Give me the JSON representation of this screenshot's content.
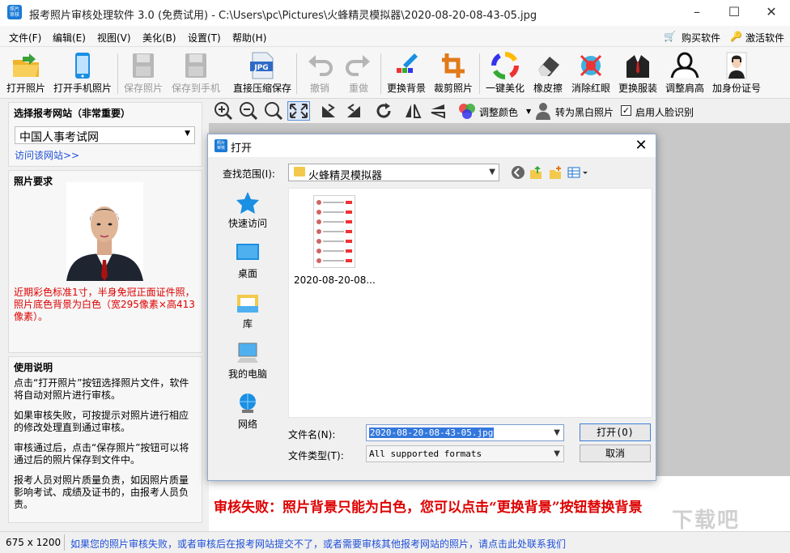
{
  "window": {
    "title": "报考照片审核处理软件 3.0 (免费试用) - C:\\Users\\pc\\Pictures\\火蜂精灵模拟器\\2020-08-20-08-43-05.jpg",
    "icon_text": "照片 审核"
  },
  "menu": {
    "items": [
      "文件(F)",
      "编辑(E)",
      "视图(V)",
      "美化(B)",
      "设置(T)",
      "帮助(H)"
    ],
    "buy": "购买软件",
    "activate": "激活软件"
  },
  "toolbar": {
    "open_photo": "打开照片",
    "open_phone_photo": "打开手机照片",
    "save_photo": "保存照片",
    "save_to_phone": "保存到手机",
    "compress_save": "直接压缩保存",
    "compress_badge": "JPG",
    "undo": "撤销",
    "redo": "重做",
    "change_bg": "更换背景",
    "crop": "裁剪照片",
    "beautify": "一键美化",
    "eraser": "橡皮擦",
    "remove_redeye": "消除红眼",
    "change_clothes": "更换服装",
    "adjust_shoulder": "调整肩高",
    "add_id": "加身份证号"
  },
  "left": {
    "site_title": "选择报考网站（非常重要）",
    "site_value": "中国人事考试网",
    "visit_link": "访问该网站>>",
    "req_title": "照片要求",
    "req_text": "近期彩色标准1寸，半身免冠正面证件照，照片底色背景为白色（宽295像素×高413像素）。",
    "usage_title": "使用说明",
    "usage_paragraphs": [
      "点击“打开照片”按钮选择照片文件，软件将自动对照片进行审核。",
      "如果审核失败，可按提示对照片进行相应的修改处理直到通过审核。",
      "审核通过后，点击“保存照片”按钮可以将通过后的照片保存到文件中。",
      "报考人员对照片质量负责，如因照片质量影响考试、成绩及证书的，由报考人员负责。"
    ]
  },
  "image_tools": {
    "adjust_color": "调整颜色",
    "to_bw": "转为黑白照片",
    "face_detect": "启用人脸识别"
  },
  "error_message": "审核失败：照片背景只能为白色，您可以点击“更换背景”按钮替换背景",
  "status": {
    "size": "675 x 1200",
    "message": "如果您的照片审核失败，或者审核后在报考网站提交不了，或者需要审核其他报考网站的照片，请点击此处联系我们"
  },
  "dialog": {
    "title": "打开",
    "look_in_label": "查找范围(I):",
    "look_in_value": "火蜂精灵模拟器",
    "places": [
      "快速访问",
      "桌面",
      "库",
      "我的电脑",
      "网络"
    ],
    "file_name_display": "2020-08-20-08...",
    "filename_label": "文件名(N):",
    "filename_value": "2020-08-20-08-43-05.jpg",
    "filetype_label": "文件类型(T):",
    "filetype_value": "All supported formats",
    "open_button": "打开(O)",
    "cancel_button": "取消"
  },
  "watermark": "下载吧",
  "colors": {
    "accent": "#1e4fd8",
    "error": "#dd0000",
    "selection": "#3377dd"
  }
}
